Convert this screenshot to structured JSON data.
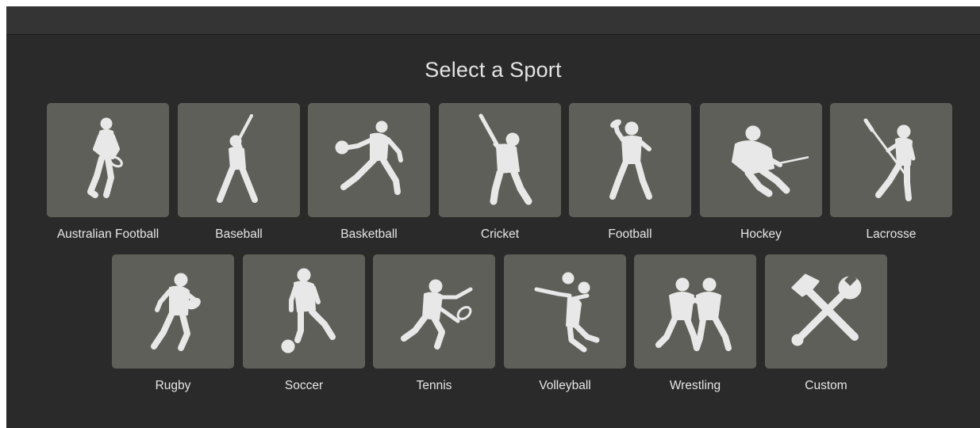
{
  "heading": "Select a Sport",
  "sports_row1": [
    {
      "label": "Australian Football",
      "icon": "australian-football-player-icon"
    },
    {
      "label": "Baseball",
      "icon": "baseball-player-icon"
    },
    {
      "label": "Basketball",
      "icon": "basketball-player-icon"
    },
    {
      "label": "Cricket",
      "icon": "cricket-player-icon"
    },
    {
      "label": "Football",
      "icon": "football-player-icon"
    },
    {
      "label": "Hockey",
      "icon": "hockey-player-icon"
    },
    {
      "label": "Lacrosse",
      "icon": "lacrosse-player-icon"
    }
  ],
  "sports_row2": [
    {
      "label": "Rugby",
      "icon": "rugby-player-icon"
    },
    {
      "label": "Soccer",
      "icon": "soccer-player-icon"
    },
    {
      "label": "Tennis",
      "icon": "tennis-player-icon"
    },
    {
      "label": "Volleyball",
      "icon": "volleyball-player-icon"
    },
    {
      "label": "Wrestling",
      "icon": "wrestlers-icon"
    },
    {
      "label": "Custom",
      "icon": "hammer-wrench-icon"
    }
  ],
  "colors": {
    "window_bg": "#2a2a2a",
    "titlebar_bg": "#343434",
    "tile_bg": "#5f5f5a",
    "silhouette": "#e8e8e8",
    "text": "#e6e6e6"
  }
}
